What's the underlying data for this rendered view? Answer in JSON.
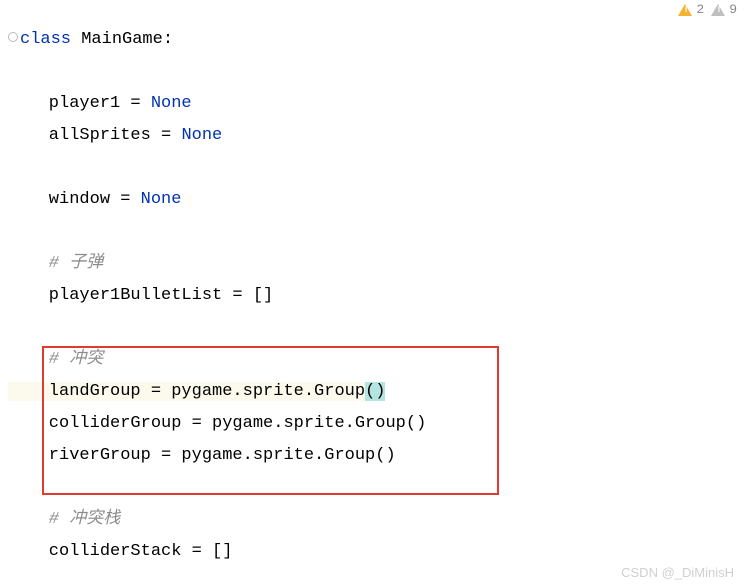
{
  "warnings": {
    "yellow_count": "2",
    "gray_count": "9"
  },
  "code": {
    "l1_kw": "class",
    "l1_name": " MainGame:",
    "l2_var": "    player1 = ",
    "l2_none": "None",
    "l3_var": "    allSprites = ",
    "l3_none": "None",
    "l4_var": "    window = ",
    "l4_none": "None",
    "l5_comment": "    # 子弹",
    "l6": "    player1BulletList = []",
    "l7_comment": "    # 冲突",
    "l8a": "    landGroup = pygame.sprite.Group",
    "l8b": "()",
    "l9": "    colliderGroup = pygame.sprite.Group()",
    "l10": "    riverGroup = pygame.sprite.Group()",
    "l11_comment": "    # 冲突栈",
    "l12": "    colliderStack = []"
  },
  "watermark": "CSDN @_DiMinisH"
}
